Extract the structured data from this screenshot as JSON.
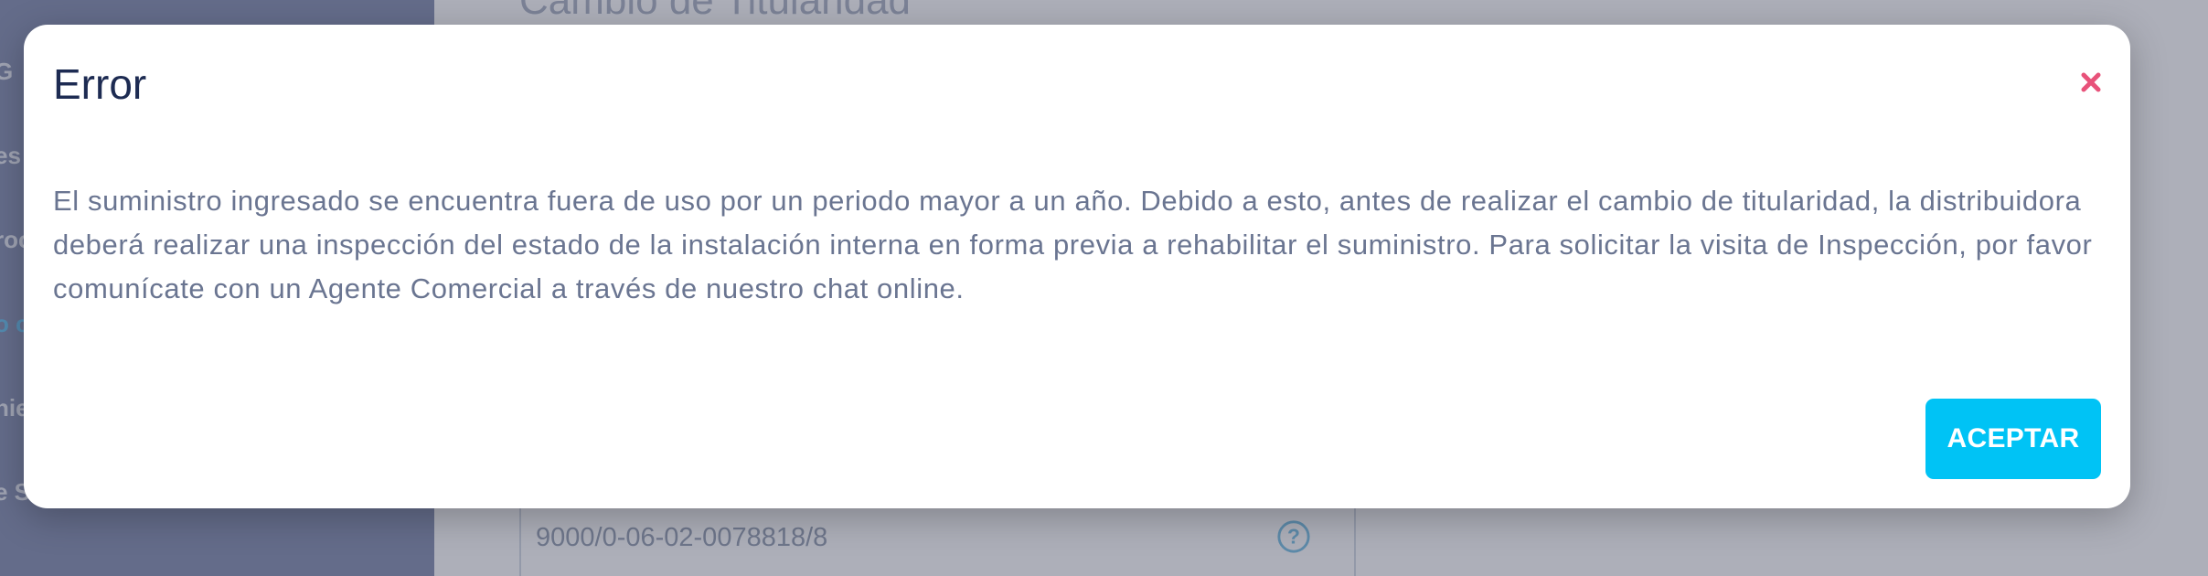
{
  "background": {
    "sidebar": {
      "items": [
        {
          "label": "G"
        },
        {
          "label": "es"
        },
        {
          "label": "roc"
        },
        {
          "label": "o c",
          "active": true
        },
        {
          "label": "nie"
        },
        {
          "label": "e S"
        }
      ]
    },
    "page_title": "Cambio de Titularidad",
    "supply_field": {
      "value": "9000/0-06-02-0078818/8"
    }
  },
  "modal": {
    "title": "Error",
    "body": "El suministro ingresado se encuentra fuera de uso por un periodo mayor a un año. Debido a esto, antes de realizar el cambio de titularidad, la distribuidora deberá realizar una inspección del estado de la instalación interna en forma previa a rehabilitar el suministro. Para solicitar la visita de Inspección, por favor comunícate con un Agente Comercial a través de nuestro chat online.",
    "accept_label": "ACEPTAR"
  },
  "colors": {
    "accent": "#00c3f5",
    "close": "#e8527a",
    "title": "#1d2b52",
    "body_text": "#6a7591",
    "sidebar": "#8a94b3"
  },
  "icons": {
    "close": "close-icon",
    "help": "help-icon"
  }
}
